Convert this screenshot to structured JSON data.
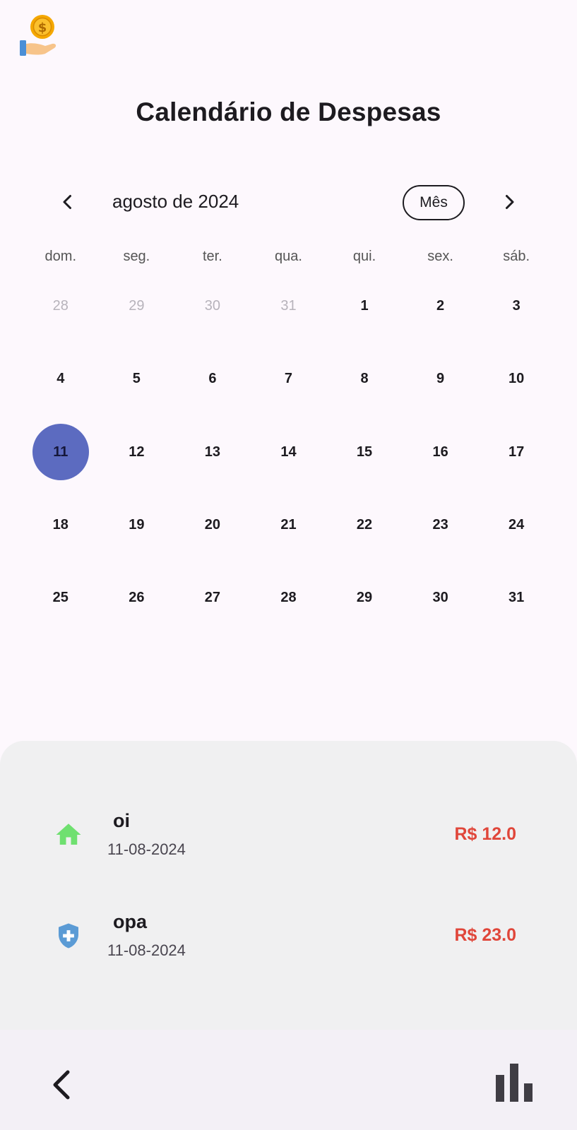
{
  "app": {
    "logo_icon": "coin-in-hand-icon",
    "title": "Calendário de Despesas"
  },
  "calendar": {
    "month_label": "agosto de 2024",
    "format_button": "Mês",
    "prev_icon": "chevron-left-icon",
    "next_icon": "chevron-right-icon",
    "selected_color": "#5c6bc0",
    "weekdays": [
      "dom.",
      "seg.",
      "ter.",
      "qua.",
      "qui.",
      "sex.",
      "sáb."
    ],
    "weeks": [
      [
        {
          "d": "28",
          "out": true
        },
        {
          "d": "29",
          "out": true
        },
        {
          "d": "30",
          "out": true
        },
        {
          "d": "31",
          "out": true
        },
        {
          "d": "1"
        },
        {
          "d": "2"
        },
        {
          "d": "3"
        }
      ],
      [
        {
          "d": "4"
        },
        {
          "d": "5"
        },
        {
          "d": "6"
        },
        {
          "d": "7"
        },
        {
          "d": "8"
        },
        {
          "d": "9"
        },
        {
          "d": "10"
        }
      ],
      [
        {
          "d": "11",
          "selected": true
        },
        {
          "d": "12"
        },
        {
          "d": "13"
        },
        {
          "d": "14"
        },
        {
          "d": "15"
        },
        {
          "d": "16"
        },
        {
          "d": "17"
        }
      ],
      [
        {
          "d": "18"
        },
        {
          "d": "19"
        },
        {
          "d": "20"
        },
        {
          "d": "21"
        },
        {
          "d": "22"
        },
        {
          "d": "23"
        },
        {
          "d": "24"
        }
      ],
      [
        {
          "d": "25"
        },
        {
          "d": "26"
        },
        {
          "d": "27"
        },
        {
          "d": "28"
        },
        {
          "d": "29"
        },
        {
          "d": "30"
        },
        {
          "d": "31"
        }
      ]
    ]
  },
  "expenses": [
    {
      "icon": "home-icon",
      "icon_color": "#6fe070",
      "name": "oi",
      "date": "11-08-2024",
      "amount": "R$ 12.0"
    },
    {
      "icon": "health-shield-icon",
      "icon_color": "#5b9bd5",
      "name": "opa",
      "date": "11-08-2024",
      "amount": "R$ 23.0"
    }
  ],
  "amount_color": "#e0463a",
  "bottom_nav": {
    "back_icon": "chevron-left-icon",
    "stats_icon": "bar-chart-icon"
  }
}
